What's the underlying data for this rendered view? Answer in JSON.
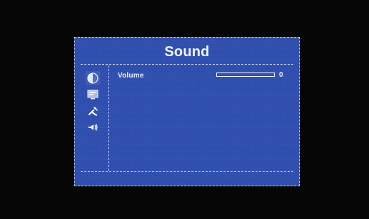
{
  "menu": {
    "title": "Sound",
    "tabs": [
      {
        "icon": "picture-icon"
      },
      {
        "icon": "display-icon"
      },
      {
        "icon": "tools-icon"
      },
      {
        "icon": "audio-speaker-icon"
      }
    ]
  },
  "settings": [
    {
      "label": "Volume",
      "value": "0",
      "level": 0
    }
  ],
  "colors": {
    "background": "#060606",
    "panel": "#2f4fb0",
    "text": "#eef2ff",
    "accent_lines": "#c7d2f4"
  }
}
